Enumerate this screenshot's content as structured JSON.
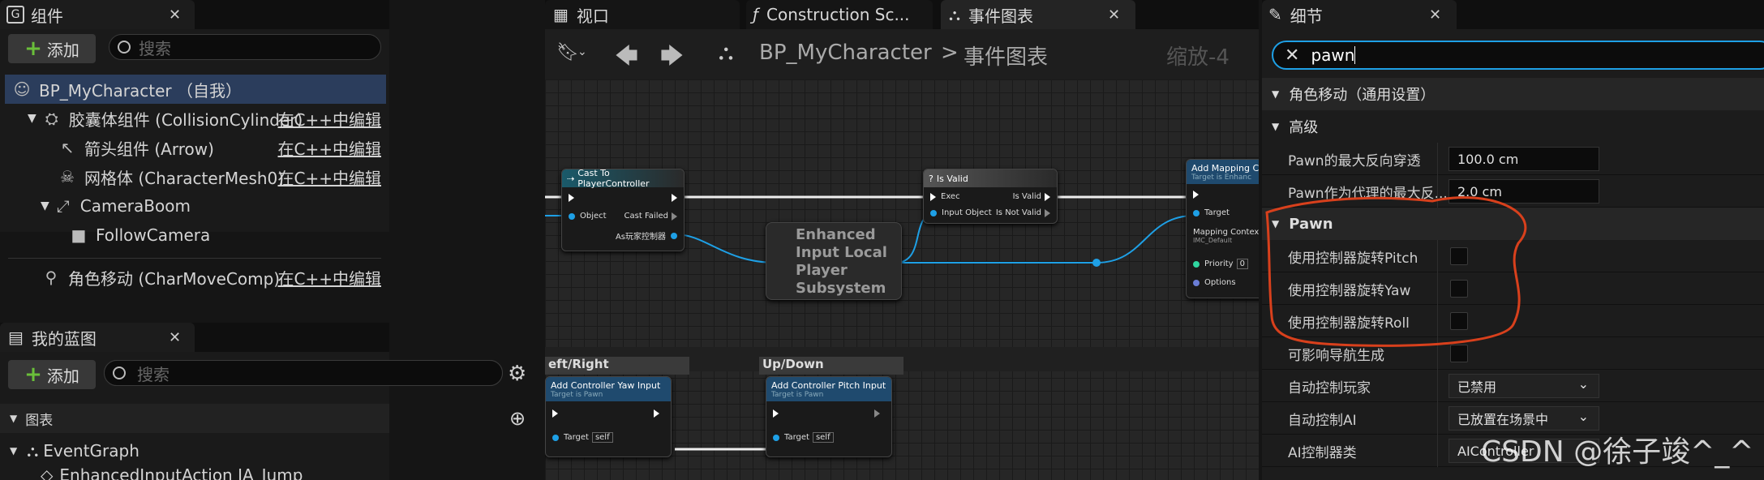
{
  "left_panel": {
    "components_tab": "组件",
    "add_label": "添加",
    "search_placeholder": "搜索",
    "root": "BP_MyCharacter （自我）",
    "edit_cpp": "在C++中编辑",
    "components": [
      {
        "label": "胶囊体组件 (CollisionCylinder)",
        "icon": "capsule-icon",
        "editable": true
      },
      {
        "label": "箭头组件 (Arrow)",
        "icon": "arrow-icon",
        "editable": true
      },
      {
        "label": "网格体 (CharacterMesh0)",
        "icon": "skeleton-icon",
        "editable": true
      },
      {
        "label": "CameraBoom",
        "icon": "spring-arm-icon",
        "editable": false
      },
      {
        "label": "FollowCamera",
        "icon": "camera-icon",
        "editable": false
      },
      {
        "label": "角色移动 (CharMoveComp)",
        "icon": "movement-icon",
        "editable": true
      }
    ],
    "blueprint_tab": "我的蓝图",
    "bp_add_label": "添加",
    "bp_search_placeholder": "搜索",
    "graphs_section": "图表",
    "event_graph": "EventGraph",
    "truncated_item": "EnhancedInputAction IA_Jump"
  },
  "center": {
    "tabs": [
      "视口",
      "Construction Sc...",
      "事件图表"
    ],
    "breadcrumb_root": "BP_MyCharacter",
    "breadcrumb_sep": ">",
    "breadcrumb_current": "事件图表",
    "zoom": "缩放-4",
    "nodes": {
      "cast": {
        "title": "Cast To PlayerController",
        "object": "Object",
        "cast_failed": "Cast Failed",
        "as_pc": "As玩家控制器"
      },
      "subsystem": {
        "title": "Enhanced Input Local Player Subsystem"
      },
      "is_valid": {
        "title": "Is Valid",
        "exec": "Exec",
        "is_valid": "Is Valid",
        "input_object": "Input Object",
        "is_not_valid": "Is Not Valid"
      },
      "add_mapping": {
        "title": "Add Mapping C",
        "subtitle": "Target is Enhanc",
        "target": "Target",
        "mapping_context": "Mapping Contex",
        "mapping_value": "IMC_Default",
        "priority": "Priority",
        "priority_value": "0",
        "options": "Options"
      },
      "comment_lr": "eft/Right",
      "comment_ud": "Up/Down",
      "yaw": {
        "title": "Add Controller Yaw Input",
        "subtitle": "Target is Pawn",
        "target": "Target",
        "self": "self"
      },
      "pitch": {
        "title": "Add Controller Pitch Input",
        "subtitle": "Target is Pawn",
        "target": "Target",
        "self": "self"
      }
    }
  },
  "details": {
    "tab": "细节",
    "search_value": "pawn",
    "section_movement": "角色移动（通用设置）",
    "section_advanced": "高级",
    "section_pawn": "Pawn",
    "rows": [
      {
        "label": "Pawn的最大反向穿透",
        "type": "value",
        "value": "100.0 cm"
      },
      {
        "label": "Pawn作为代理的最大反...",
        "type": "value",
        "value": "2.0 cm"
      },
      {
        "label": "使用控制器旋转Pitch",
        "type": "check"
      },
      {
        "label": "使用控制器旋转Yaw",
        "type": "check"
      },
      {
        "label": "使用控制器旋转Roll",
        "type": "check"
      },
      {
        "label": "可影响导航生成",
        "type": "check"
      },
      {
        "label": "自动控制玩家",
        "type": "dropdown",
        "value": "已禁用"
      },
      {
        "label": "自动控制AI",
        "type": "dropdown",
        "value": "已放置在场景中"
      },
      {
        "label": "AI控制器类",
        "type": "dropdown",
        "value": "AIController"
      }
    ]
  },
  "watermark": "CSDN @徐子竣^_^",
  "colors": {
    "accent_blue": "#1ea0e6",
    "annotation_red": "#d8401c",
    "selected_row": "#2a3a55",
    "add_green": "#6abf3a"
  }
}
